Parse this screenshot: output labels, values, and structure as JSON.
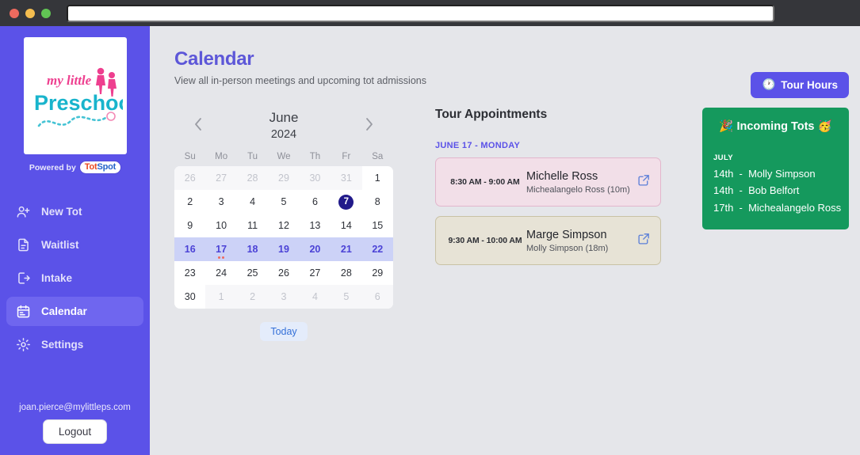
{
  "browser": {
    "url_value": "",
    "url_placeholder": ""
  },
  "sidebar": {
    "logo_line1": "my little",
    "logo_line2": "Preschool",
    "powered_by": "Powered by",
    "brand_tot": "Tot",
    "brand_spot": "Spot",
    "items": [
      {
        "label": "New Tot",
        "icon": "user-plus-icon",
        "active": false
      },
      {
        "label": "Waitlist",
        "icon": "document-icon",
        "active": false
      },
      {
        "label": "Intake",
        "icon": "login-arrow-icon",
        "active": false
      },
      {
        "label": "Calendar",
        "icon": "calendar-icon",
        "active": true
      },
      {
        "label": "Settings",
        "icon": "gear-icon",
        "active": false
      }
    ],
    "email": "joan.pierce@mylittleps.com",
    "logout_label": "Logout"
  },
  "header": {
    "title": "Calendar",
    "subtitle": "View all in-person meetings and upcoming tot admissions",
    "tour_hours_label": "Tour Hours",
    "tour_hours_icon": "clock-emoji"
  },
  "calendar": {
    "month": "June",
    "year": "2024",
    "prev_icon": "chevron-left-icon",
    "next_icon": "chevron-right-icon",
    "dow": [
      "Su",
      "Mo",
      "Tu",
      "We",
      "Th",
      "Fr",
      "Sa"
    ],
    "today_label": "Today",
    "weeks": [
      [
        {
          "d": "26",
          "muted": true
        },
        {
          "d": "27",
          "muted": true
        },
        {
          "d": "28",
          "muted": true
        },
        {
          "d": "29",
          "muted": true
        },
        {
          "d": "30",
          "muted": true
        },
        {
          "d": "31",
          "muted": true
        },
        {
          "d": "1"
        }
      ],
      [
        {
          "d": "2"
        },
        {
          "d": "3"
        },
        {
          "d": "4"
        },
        {
          "d": "5"
        },
        {
          "d": "6"
        },
        {
          "d": "7",
          "today": true
        },
        {
          "d": "8"
        }
      ],
      [
        {
          "d": "9"
        },
        {
          "d": "10"
        },
        {
          "d": "11"
        },
        {
          "d": "12"
        },
        {
          "d": "13"
        },
        {
          "d": "14"
        },
        {
          "d": "15"
        }
      ],
      [
        {
          "d": "16",
          "selweek": true
        },
        {
          "d": "17",
          "selweek": true,
          "dots": 2
        },
        {
          "d": "18",
          "selweek": true
        },
        {
          "d": "19",
          "selweek": true
        },
        {
          "d": "20",
          "selweek": true
        },
        {
          "d": "21",
          "selweek": true
        },
        {
          "d": "22",
          "selweek": true
        }
      ],
      [
        {
          "d": "23"
        },
        {
          "d": "24"
        },
        {
          "d": "25"
        },
        {
          "d": "26"
        },
        {
          "d": "27"
        },
        {
          "d": "28"
        },
        {
          "d": "29"
        }
      ],
      [
        {
          "d": "30"
        },
        {
          "d": "1",
          "muted": true
        },
        {
          "d": "2",
          "muted": true
        },
        {
          "d": "3",
          "muted": true
        },
        {
          "d": "4",
          "muted": true
        },
        {
          "d": "5",
          "muted": true
        },
        {
          "d": "6",
          "muted": true
        }
      ]
    ]
  },
  "appointments": {
    "title": "Tour Appointments",
    "date_label": "JUNE 17 - MONDAY",
    "items": [
      {
        "time": "8:30 AM - 9:00 AM",
        "name": "Michelle Ross",
        "child": "Michealangelo Ross (10m)",
        "style": "pink",
        "link_icon": "external-link-icon"
      },
      {
        "time": "9:30 AM - 10:00 AM",
        "name": "Marge Simpson",
        "child": "Molly Simpson (18m)",
        "style": "tan",
        "link_icon": "external-link-icon"
      }
    ]
  },
  "incoming_tots": {
    "title": "Incoming Tots",
    "emoji_left": "🎉",
    "emoji_right": "🥳",
    "month": "JULY",
    "rows": [
      {
        "day": "14th",
        "sep": "-",
        "name": "Molly Simpson"
      },
      {
        "day": "14th",
        "sep": "-",
        "name": "Bob Belfort"
      },
      {
        "day": "17th",
        "sep": "-",
        "name": "Michealangelo Ross"
      }
    ]
  },
  "colors": {
    "sidebar": "#5b52e8",
    "accent": "#5b52e8",
    "green_card": "#15995d",
    "today_circle": "#211a8a",
    "selected_week": "#ccd2f7",
    "pink_card": "#f2dfe8",
    "tan_card": "#e7e3d6"
  }
}
